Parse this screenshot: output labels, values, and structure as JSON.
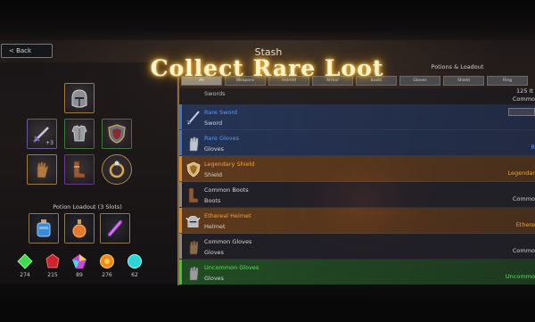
{
  "nav": {
    "back_label": "< Back"
  },
  "header": {
    "stash_title": "Stash",
    "banner": "Collect Rare Loot",
    "loadout_title": "Potions & Loadout"
  },
  "tabs": [
    {
      "label": "All",
      "active": true
    },
    {
      "label": "Weapons"
    },
    {
      "label": "Helmet"
    },
    {
      "label": "Armor"
    },
    {
      "label": "Boots"
    },
    {
      "label": "Gloves"
    },
    {
      "label": "Shield"
    },
    {
      "label": "Ring"
    }
  ],
  "equipment": {
    "weapon_count": "+3"
  },
  "potion_loadout": {
    "title": "Potion Loadout (3 Slots)"
  },
  "currencies": [
    {
      "icon": "green-gem-icon",
      "amount": "274",
      "color": "#3fdc4a"
    },
    {
      "icon": "red-gem-icon",
      "amount": "215",
      "color": "#d0232a"
    },
    {
      "icon": "rainbow-gem-icon",
      "amount": "89",
      "color": "#c84ad8"
    },
    {
      "icon": "orange-gem-icon",
      "amount": "276",
      "color": "#f08a1a"
    },
    {
      "icon": "cyan-gem-icon",
      "amount": "62",
      "color": "#2ad6d6"
    }
  ],
  "stash": {
    "partial_top": {
      "type": "Swords",
      "qty": "125 It",
      "rarity": "Commo"
    },
    "items": [
      {
        "name": "Rare Sword",
        "type": "Sword",
        "rarity": "",
        "name_color": "#5b9bf0",
        "rarity_color": "#5b9bf0",
        "icon": "sword-icon",
        "bar": "#3a78d8"
      },
      {
        "name": "Rare Gloves",
        "type": "Gloves",
        "rarity": "R",
        "name_color": "#5b9bf0",
        "rarity_color": "#5b9bf0",
        "icon": "gloves-icon",
        "bar": "#3a78d8"
      },
      {
        "name": "Legendary Shield",
        "type": "Shield",
        "rarity": "Legendar",
        "name_color": "#f0a23a",
        "rarity_color": "#f0a23a",
        "icon": "shield-icon",
        "bar": "#e08a20"
      },
      {
        "name": "Common Boots",
        "type": "Boots",
        "rarity": "Commo",
        "name_color": "#d8d8d8",
        "rarity_color": "#d0d0d0",
        "icon": "boots-icon",
        "bar": "#888888"
      },
      {
        "name": "Ethereal Helmet",
        "type": "Helmet",
        "rarity": "Ethere",
        "name_color": "#f0a23a",
        "rarity_color": "#f0a23a",
        "icon": "helmet-icon",
        "bar": "#e08a20"
      },
      {
        "name": "Common Gloves",
        "type": "Gloves",
        "rarity": "Commo",
        "name_color": "#d8d8d8",
        "rarity_color": "#d0d0d0",
        "icon": "gloves-icon",
        "bar": "#888888"
      },
      {
        "name": "Uncommon Gloves",
        "type": "Gloves",
        "rarity": "Uncommo",
        "name_color": "#5fe05f",
        "rarity_color": "#5fe05f",
        "icon": "gloves-icon",
        "bar": "#3cc83c"
      }
    ]
  }
}
